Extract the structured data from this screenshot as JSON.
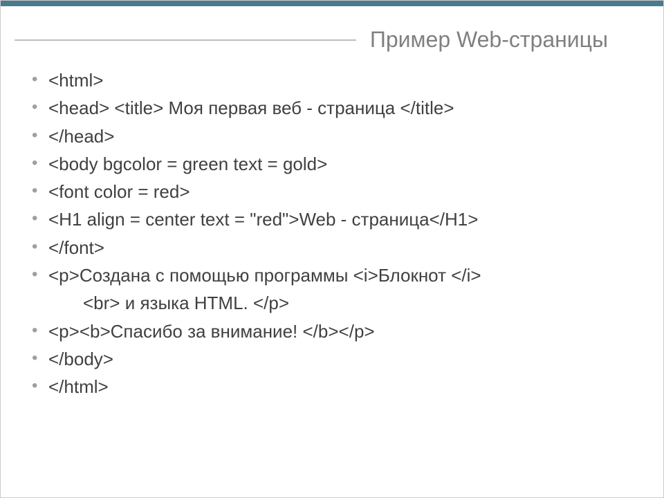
{
  "slide": {
    "title": "Пример Web-страницы",
    "lines": [
      "<html>",
      "<head> <title> Моя первая веб - страница </title>",
      "</head>",
      "<body bgcolor = green text = gold>",
      "<font color = red>",
      "<H1 align = center text = \"red\">Web - страница</H1>",
      "</font>",
      "<p>Создана с помощью программы <i>Блокнот </i> <br> и языка HTML. </p>",
      "<p><b>Спасибо за внимание! </b></p>",
      "</body>",
      "</html>"
    ],
    "lines_display": {
      "l0": "<html>",
      "l1": "<head> <title> Моя первая веб - страница </title>",
      "l2": "</head>",
      "l3": "<body bgcolor = green text = gold>",
      "l4": "<font color = red>",
      "l5": "<H1 align = center text = \"red\">Web - страница</H1>",
      "l6": "</font>",
      "l7a": "<p>Создана с помощью программы <i>Блокнот </i>",
      "l7b": "<br> и языка HTML. </p>",
      "l8": "<p><b>Спасибо за внимание! </b></p>",
      "l9": "</body>",
      "l10": "</html>"
    }
  }
}
